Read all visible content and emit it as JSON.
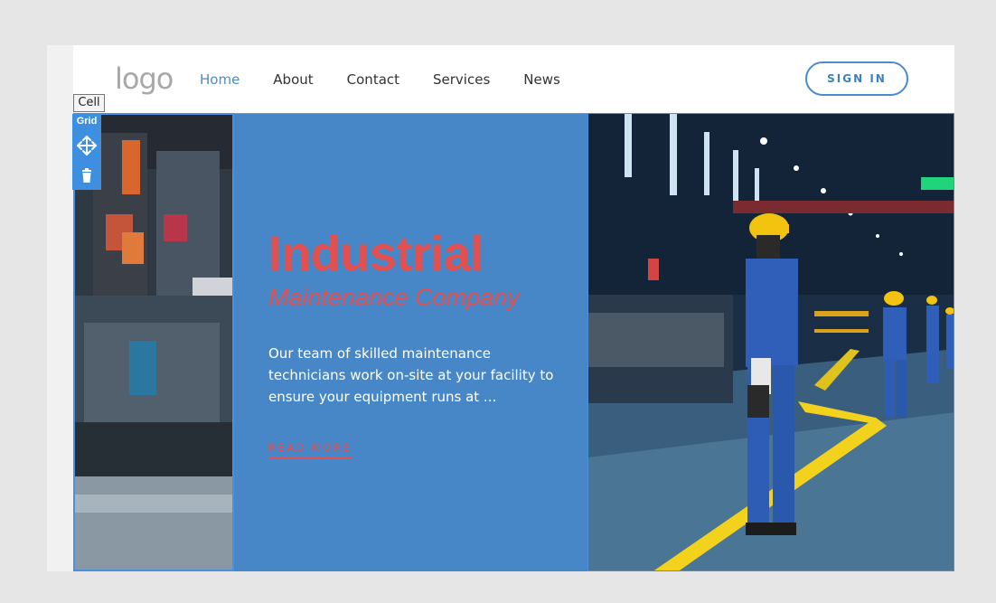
{
  "header": {
    "logo_text": "logo",
    "nav": [
      {
        "label": "Home",
        "active": true
      },
      {
        "label": "About",
        "active": false
      },
      {
        "label": "Contact",
        "active": false
      },
      {
        "label": "Services",
        "active": false
      },
      {
        "label": "News",
        "active": false
      }
    ],
    "signin_label": "SIGN IN"
  },
  "editor": {
    "cell_tag": "Cell",
    "grid_label": "Grid",
    "move_icon": "move-arrows-icon",
    "delete_icon": "trash-icon"
  },
  "hero": {
    "title": "Industrial",
    "subtitle": "Maintenance Company",
    "description": "Our team of skilled maintenance technicians work on-site at your facility to ensure your equipment runs at ...",
    "read_more": "READ MORE"
  },
  "colors": {
    "accent_blue": "#4a8bd0",
    "panel_blue": "#4787c8",
    "title_red": "#e25050",
    "editor_blue": "#3e8fe0"
  }
}
